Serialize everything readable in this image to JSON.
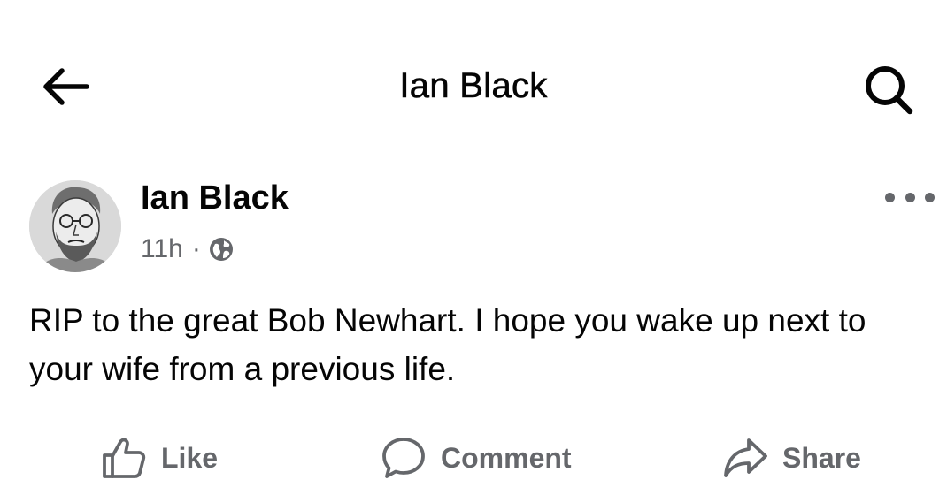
{
  "header": {
    "title": "Ian Black"
  },
  "icons": {
    "back": "arrow-left-icon",
    "search": "search-icon",
    "more": "more-horizontal-icon",
    "privacy": "globe-icon",
    "like": "thumbs-up-icon",
    "comment": "comment-bubble-icon",
    "share": "share-arrow-icon"
  },
  "post": {
    "author": "Ian Black",
    "time": "11h",
    "separator": "·",
    "text": "RIP to the great Bob Newhart. I hope you wake up next to your wife from a previous life."
  },
  "actions": {
    "like": "Like",
    "comment": "Comment",
    "share": "Share"
  },
  "colors": {
    "text": "#050505",
    "secondary": "#65676b",
    "background": "#ffffff"
  }
}
